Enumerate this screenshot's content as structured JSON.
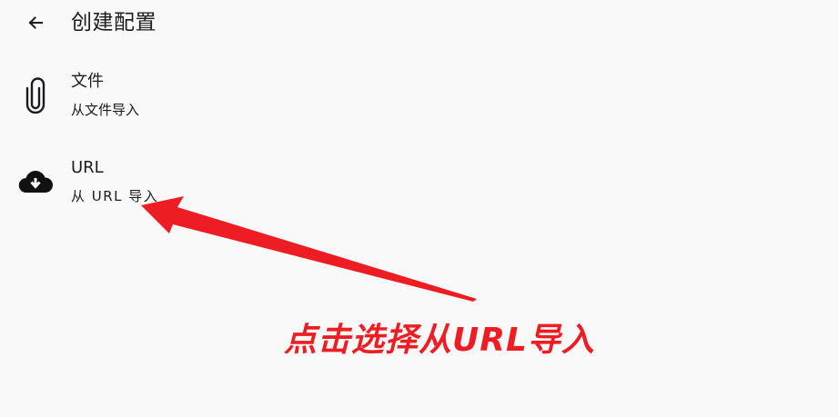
{
  "app_bar": {
    "back_icon": "arrow-left-icon",
    "title": "创建配置"
  },
  "items": [
    {
      "icon": "paperclip-icon",
      "title": "文件",
      "subtitle": "从文件导入"
    },
    {
      "icon": "cloud-download-icon",
      "title": "URL",
      "subtitle": "从 URL 导入"
    }
  ],
  "annotation": {
    "text": "点击选择从URL导入",
    "color": "#ee1d23"
  }
}
